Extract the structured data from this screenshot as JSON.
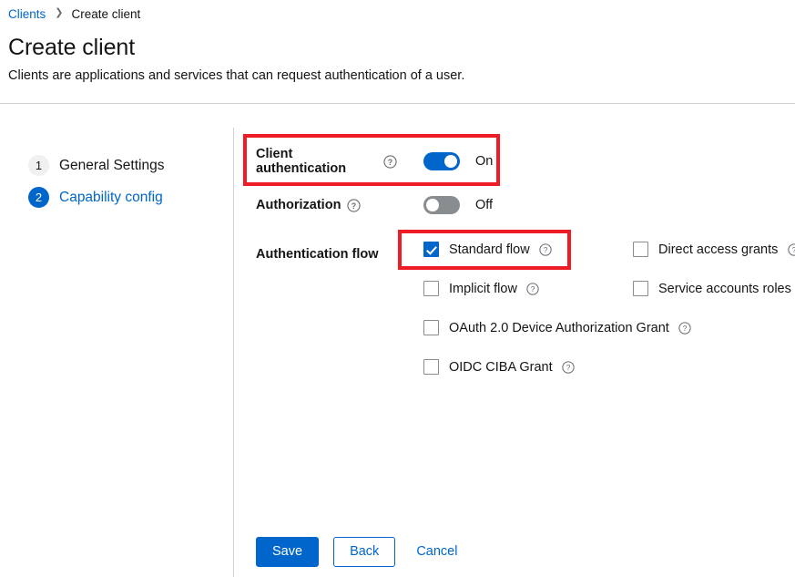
{
  "breadcrumb": {
    "parent": "Clients",
    "separator": "❯",
    "current": "Create client"
  },
  "header": {
    "title": "Create client",
    "description": "Clients are applications and services that can request authentication of a user."
  },
  "wizard_nav": {
    "steps": [
      {
        "number": "1",
        "label": "General Settings",
        "active": false
      },
      {
        "number": "2",
        "label": "Capability config",
        "active": true
      }
    ]
  },
  "form": {
    "client_authentication": {
      "label": "Client authentication",
      "help_icon": "help-circle-icon",
      "state_label": "On",
      "enabled": true
    },
    "authorization": {
      "label": "Authorization",
      "help_icon": "help-circle-icon",
      "state_label": "Off",
      "enabled": false
    },
    "authentication_flow": {
      "label": "Authentication flow",
      "options": [
        {
          "label": "Standard flow",
          "checked": true,
          "help_icon": "help-circle-icon"
        },
        {
          "label": "Direct access grants",
          "checked": false,
          "help_icon": "help-circle-icon"
        },
        {
          "label": "Implicit flow",
          "checked": false,
          "help_icon": "help-circle-icon"
        },
        {
          "label": "Service accounts roles",
          "checked": false,
          "help_icon": "help-circle-icon"
        },
        {
          "label": "OAuth 2.0 Device Authorization Grant",
          "checked": false,
          "help_icon": "help-circle-icon"
        },
        {
          "label": "OIDC CIBA Grant",
          "checked": false,
          "help_icon": "help-circle-icon"
        }
      ]
    }
  },
  "actions": {
    "save": "Save",
    "back": "Back",
    "cancel": "Cancel"
  },
  "colors": {
    "primary_blue": "#0066cc",
    "link_blue": "#0066cc",
    "toggle_off_gray": "#8a8d90",
    "annotation_red": "#ee1c25",
    "text": "#151515",
    "divider": "#d2d2d2"
  },
  "annotations": [
    {
      "name": "client-authentication-highlight",
      "target": "Client authentication"
    },
    {
      "name": "standard-flow-highlight",
      "target": "Standard flow"
    }
  ]
}
